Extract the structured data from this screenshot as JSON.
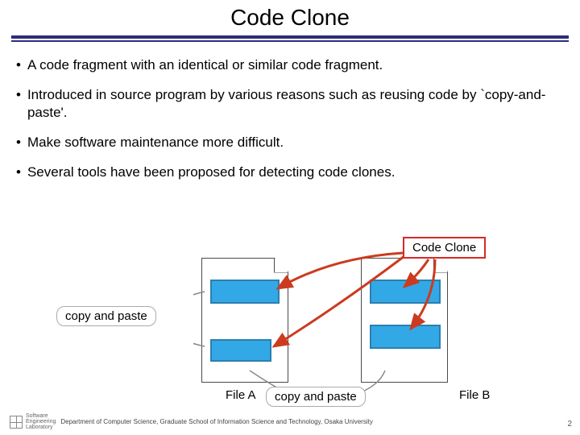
{
  "title": "Code Clone",
  "bullets": [
    "A code fragment with an identical or similar code fragment.",
    "Introduced in source program by various reasons such as reusing code by `copy-and-paste'.",
    "Make software maintenance more difficult.",
    "Several tools have been proposed for detecting code clones."
  ],
  "diagram": {
    "code_clone_label": "Code Clone",
    "copy_paste_label_left": "copy and paste",
    "copy_paste_label_bottom": "copy and paste",
    "file_a_label": "File A",
    "file_b_label": "File B"
  },
  "footer": {
    "logo_text": "Software\nEngineering\nLaboratory",
    "dept": "Department of Computer Science, Graduate School of Information Science and Technology, Osaka University",
    "page_number": "2"
  }
}
